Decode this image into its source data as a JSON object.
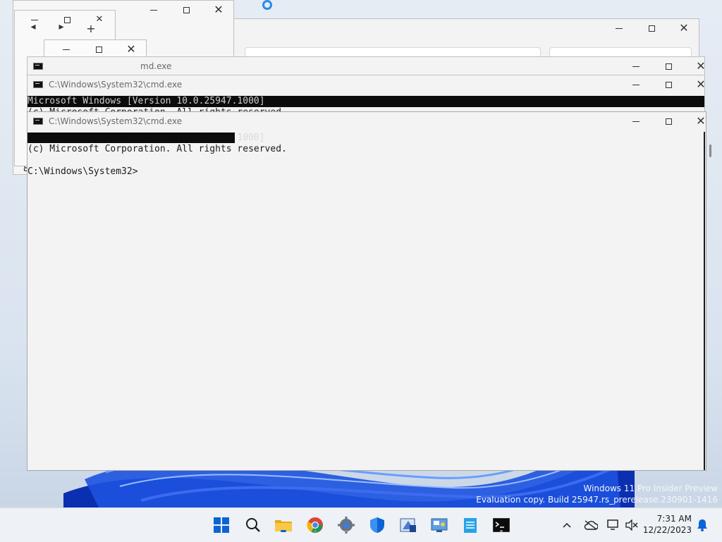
{
  "desktop": {
    "watermark_line1": "Windows 11 Pro Insider Preview",
    "watermark_line2": "Evaluation copy. Build 25947.rs_prerelease.230901-1416",
    "partial_text_behind": "8"
  },
  "windows": {
    "cmd_back": {
      "title": "C:\\Windows\\System32\\cmd.exe",
      "line1": "Microsoft Windows [Version 10.0.25947.1000]"
    },
    "cmd_mid": {
      "title": "C:\\Windows\\System32\\cmd.exe",
      "line1": "Microsoft Windows [Version 10.0.25947.1000]",
      "line2": "(c) Microsoft Corporation. All rights reserved."
    },
    "cmd_front": {
      "title": "C:\\Windows\\System32\\cmd.exe",
      "line1": "Microsoft Windows [Version 10.0.25947.1000]",
      "line2": "(c) Microsoft Corporation. All rights reserved.",
      "prompt": "C:\\Windows\\System32>"
    },
    "cmd_behind_partial_title": "md.exe"
  },
  "taskbar": {
    "items": [
      {
        "name": "start-button",
        "icon": "windows-logo-icon"
      },
      {
        "name": "search-button",
        "icon": "search-icon"
      },
      {
        "name": "file-explorer",
        "icon": "folder-icon",
        "active": true
      },
      {
        "name": "chrome",
        "icon": "chrome-icon",
        "running": true
      },
      {
        "name": "settings",
        "icon": "gear-icon",
        "running": true
      },
      {
        "name": "defender",
        "icon": "shield-icon"
      },
      {
        "name": "app-7",
        "icon": "app-icon"
      },
      {
        "name": "control-panel",
        "icon": "control-panel-icon"
      },
      {
        "name": "notepad",
        "icon": "notepad-icon"
      },
      {
        "name": "terminal",
        "icon": "terminal-icon",
        "running": true
      }
    ],
    "tray": {
      "time": "7:31 AM",
      "date": "12/22/2023"
    }
  },
  "colors": {
    "accent": "#0067c0",
    "console_bg": "#0c0c0c",
    "window_bg": "#f3f3f3"
  }
}
